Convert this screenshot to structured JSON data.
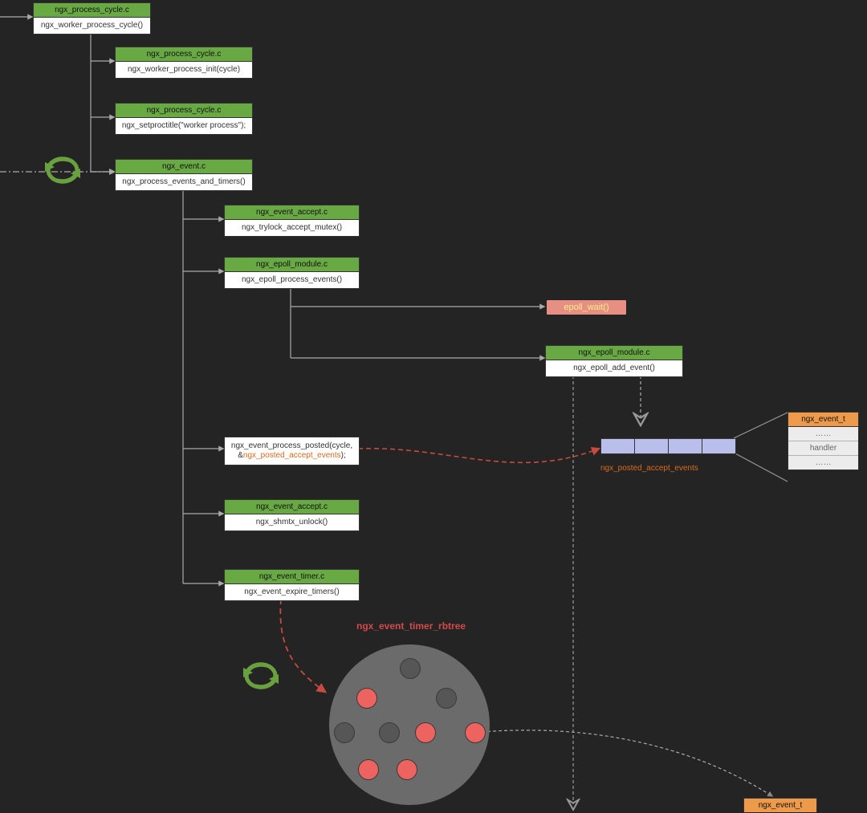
{
  "boxes": {
    "b1": {
      "file": "ngx_process_cycle.c",
      "func": "ngx_worker_process_cycle()"
    },
    "b2": {
      "file": "ngx_process_cycle.c",
      "func": "ngx_worker_process_init(cycle)"
    },
    "b3": {
      "file": "ngx_process_cycle.c",
      "func": "ngx_setproctitle(\"worker process\");"
    },
    "b4": {
      "file": "ngx_event.c",
      "func": "ngx_process_events_and_timers()"
    },
    "b5": {
      "file": "ngx_event_accept.c",
      "func": "ngx_trylock_accept_mutex()"
    },
    "b6": {
      "file": "ngx_epoll_module.c",
      "func": "ngx_epoll_process_events()"
    },
    "b7a": "ngx_event_process_posted(cycle, &",
    "b7hl": "ngx_posted_accept_events",
    "b7b": ");",
    "b8": {
      "file": "ngx_event_accept.c",
      "func": "ngx_shmtx_unlock()"
    },
    "b9": {
      "file": "ngx_event_timer.c",
      "func": "ngx_event_expire_timers()"
    },
    "b10": {
      "file": "ngx_epoll_module.c",
      "func": "ngx_epoll_add_event()"
    }
  },
  "epoll_wait": "epoll_wait()",
  "queue_label": "ngx_posted_accept_events",
  "struct1": {
    "head": "ngx_event_t",
    "r1": "……",
    "r2": "handler",
    "r3": "……"
  },
  "struct2": {
    "head": "ngx_event_t"
  },
  "rbtree_label": "ngx_event_timer_rbtree"
}
